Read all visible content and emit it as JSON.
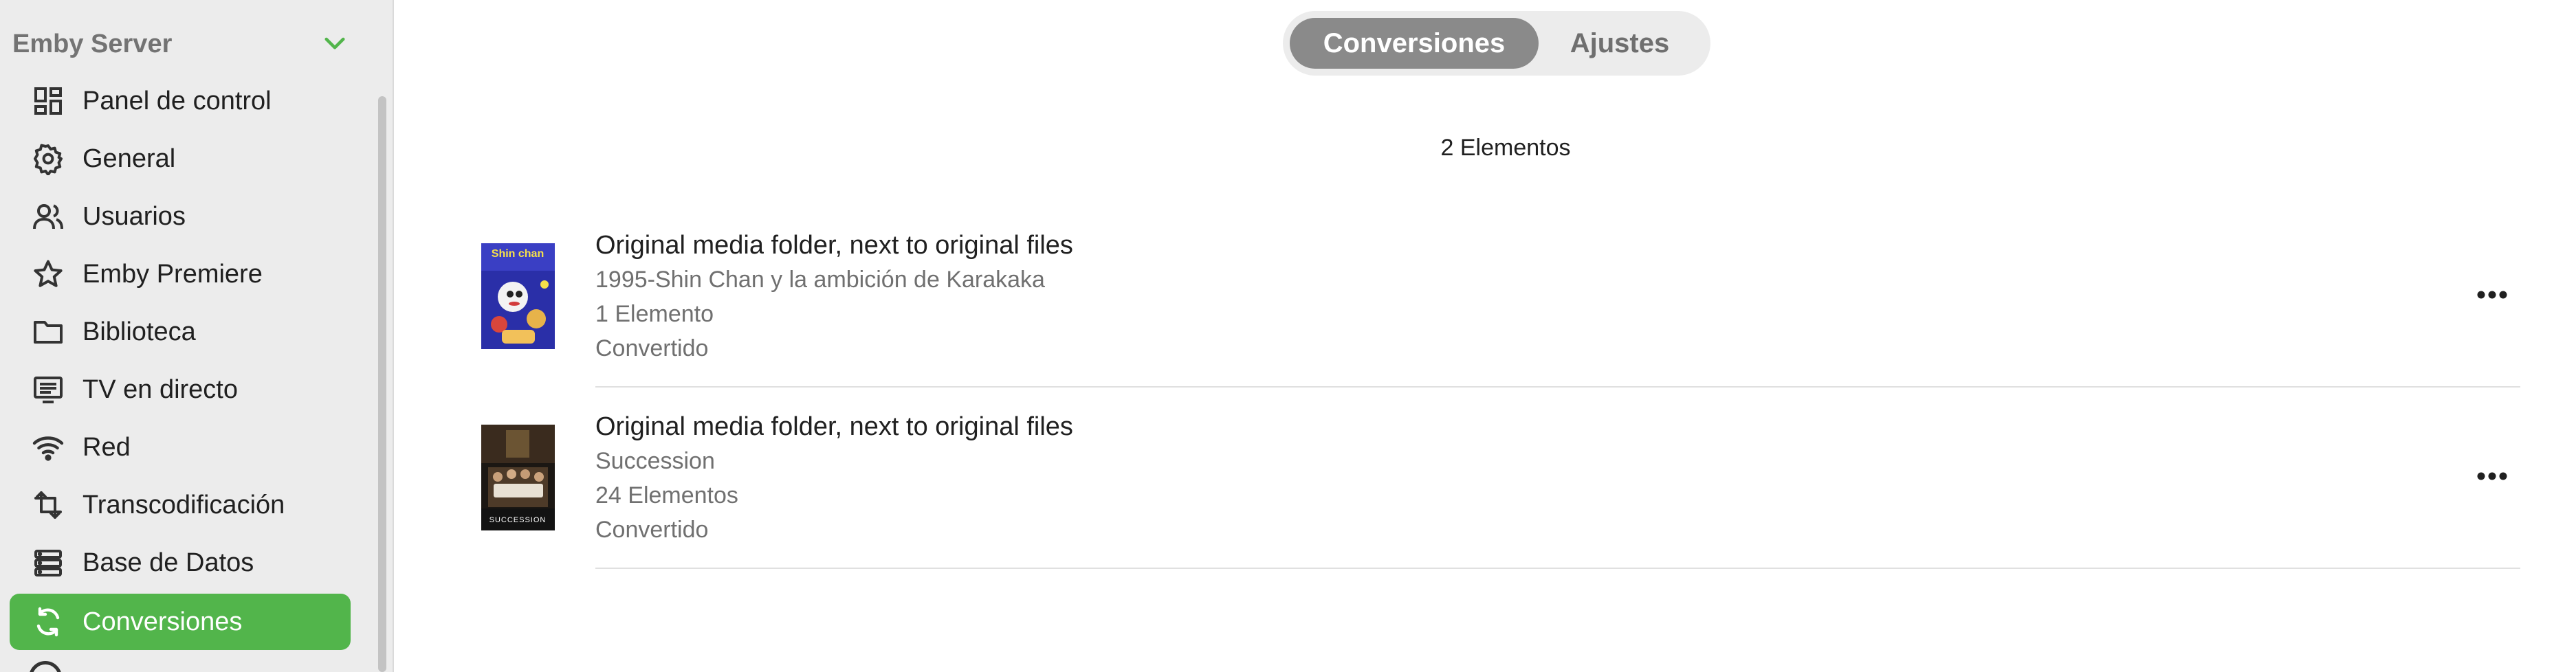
{
  "sidebar": {
    "server_name": "Emby Server",
    "items": [
      {
        "label": "Panel de control",
        "icon": "dashboard-icon"
      },
      {
        "label": "General",
        "icon": "settings-gear-icon"
      },
      {
        "label": "Usuarios",
        "icon": "users-icon"
      },
      {
        "label": "Emby Premiere",
        "icon": "star-icon"
      },
      {
        "label": "Biblioteca",
        "icon": "folder-icon"
      },
      {
        "label": "TV en directo",
        "icon": "tv-guide-icon"
      },
      {
        "label": "Red",
        "icon": "wifi-icon"
      },
      {
        "label": "Transcodificación",
        "icon": "transcode-icon"
      },
      {
        "label": "Base de Datos",
        "icon": "database-icon"
      },
      {
        "label": "Conversiones",
        "icon": "conversions-icon",
        "active": true
      }
    ],
    "accent_color": "#52b54b"
  },
  "tabs": [
    {
      "label": "Conversiones",
      "active": true
    },
    {
      "label": "Ajustes",
      "active": false
    }
  ],
  "count_text": "2 Elementos",
  "conversions": [
    {
      "title": "Original media folder, next to original files",
      "name": "1995-Shin Chan y la ambición de Karakaka",
      "count": "1 Elemento",
      "status": "Convertido"
    },
    {
      "title": "Original media folder, next to original files",
      "name": "Succession",
      "count": "24 Elementos",
      "status": "Convertido"
    }
  ],
  "posters": {
    "shinchan_text": "Shin chan",
    "succession_text": "SUCCESSION"
  }
}
